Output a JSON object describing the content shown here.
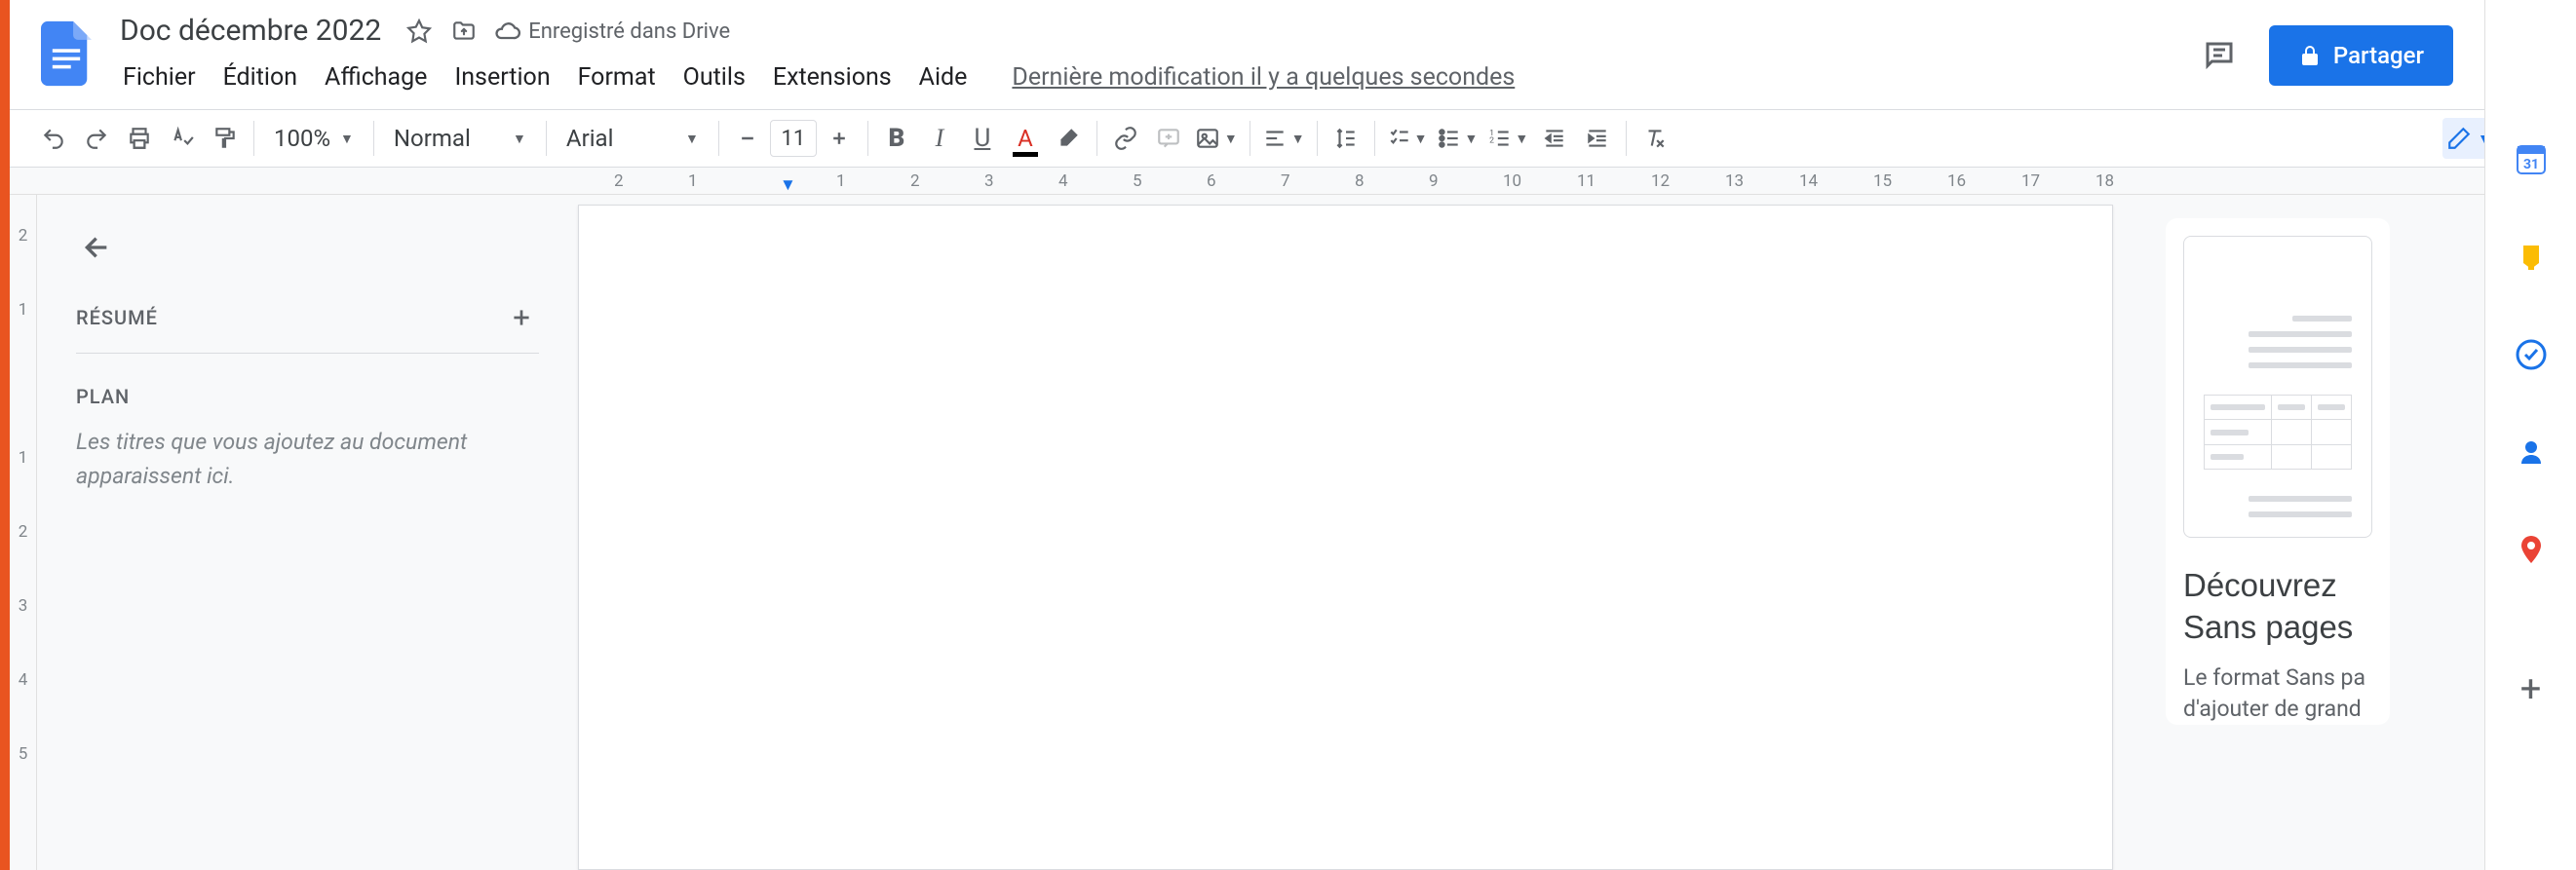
{
  "header": {
    "title": "Doc décembre 2022",
    "saved_label": "Enregistré dans Drive",
    "last_edit": "Dernière modification il y a quelques secondes"
  },
  "menu": {
    "file": "Fichier",
    "edit": "Édition",
    "view": "Affichage",
    "insert": "Insertion",
    "format": "Format",
    "tools": "Outils",
    "extensions": "Extensions",
    "help": "Aide"
  },
  "share": {
    "label": "Partager"
  },
  "toolbar": {
    "zoom": "100%",
    "style": "Normal",
    "font": "Arial",
    "size": "11"
  },
  "ruler": [
    "2",
    "1",
    "",
    "1",
    "2",
    "3",
    "4",
    "5",
    "6",
    "7",
    "8",
    "9",
    "10",
    "11",
    "12",
    "13",
    "14",
    "15",
    "16",
    "17",
    "18"
  ],
  "vruler": [
    "2",
    "1",
    "",
    "1",
    "2",
    "3",
    "4",
    "5"
  ],
  "outline": {
    "summary": "RÉSUMÉ",
    "plan": "PLAN",
    "placeholder": "Les titres que vous ajoutez au document apparaissent ici."
  },
  "promo": {
    "title": "Découvrez Sans pages",
    "text": "Le format Sans pa d'ajouter de grand"
  }
}
